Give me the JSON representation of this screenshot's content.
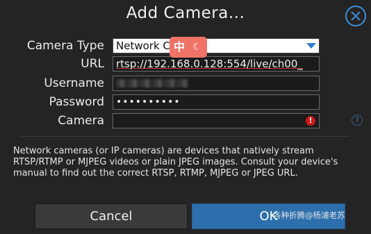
{
  "dialog": {
    "title": "Add Camera...",
    "close_icon": "close-icon",
    "accent_color": "#2d6fad"
  },
  "form": {
    "camera_type_label": "Camera Type",
    "camera_type_value": "Network C",
    "url_label": "URL",
    "url_value": "rtsp://192.168.0.128:554/live/ch00_",
    "username_label": "Username",
    "username_value": "",
    "password_label": "Password",
    "password_value": "••••••••••",
    "camera_label": "Camera",
    "camera_value": "",
    "camera_error_icon": "error-icon",
    "help_icon": "help-icon"
  },
  "description": "Network cameras (or IP cameras) are devices that natively stream RTSP/RTMP or MJPEG videos or plain JPEG images. Consult your device's manual to find out the correct RTSP, RTMP, MJPEG or JPEG URL.",
  "buttons": {
    "cancel": "Cancel",
    "ok": "OK"
  },
  "ime": {
    "label": "中",
    "moon": "☾"
  },
  "watermark": "各种折腾@杨浦老苏"
}
